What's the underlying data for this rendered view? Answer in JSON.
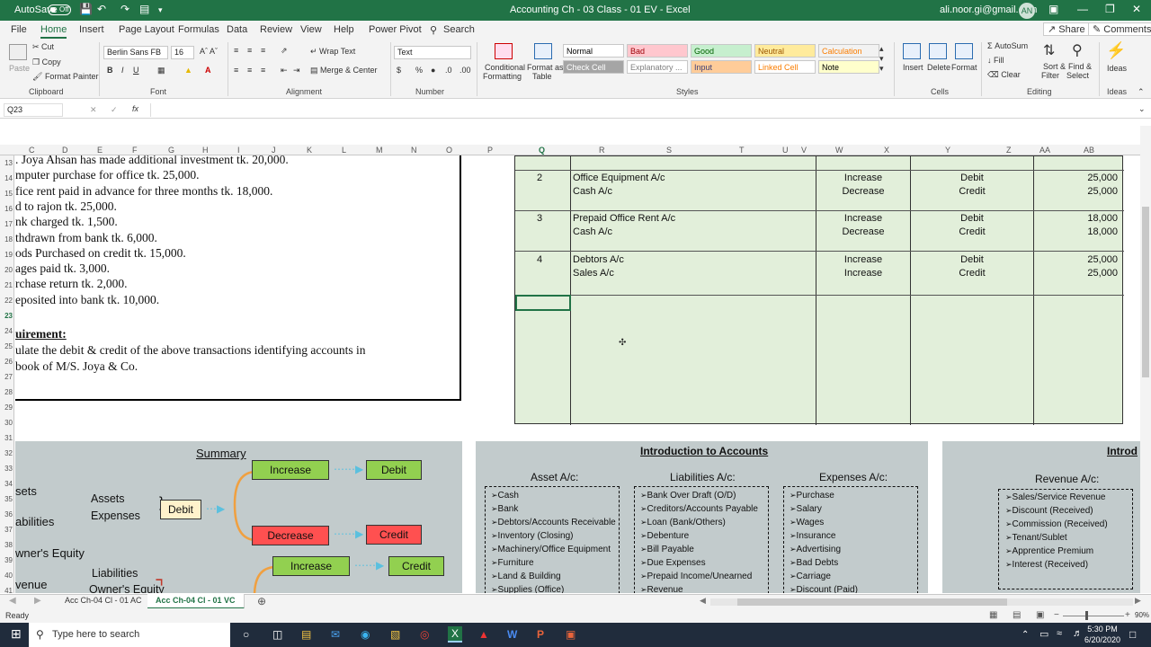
{
  "titlebar": {
    "autosave": "AutoSave",
    "toggle": "Off",
    "title": "Accounting Ch - 03 Class - 01 EV  -  Excel",
    "user": "ali.noor.gi@gmail.com",
    "avatar": "AN"
  },
  "tabs": [
    "File",
    "Home",
    "Insert",
    "Page Layout",
    "Formulas",
    "Data",
    "Review",
    "View",
    "Help",
    "Power Pivot"
  ],
  "search": "Search",
  "share": "Share",
  "comments": "Comments",
  "ribbon": {
    "paste": "Paste",
    "cut": "Cut",
    "copy": "Copy",
    "format_painter": "Format Painter",
    "clipboard": "Clipboard",
    "font_name": "Berlin Sans FB",
    "font_size": "16",
    "font": "Font",
    "wrap_text": "Wrap Text",
    "merge_center": "Merge & Center",
    "alignment": "Alignment",
    "number_format": "Text",
    "number": "Number",
    "cond_format": "Conditional",
    "cond_format2": "Formatting",
    "format_as": "Format as",
    "format_as2": "Table",
    "styles_label": "Styles",
    "styles": [
      {
        "label": "Normal",
        "bg": "#ffffff",
        "color": "#000000"
      },
      {
        "label": "Bad",
        "bg": "#ffc7ce",
        "color": "#9c0006"
      },
      {
        "label": "Good",
        "bg": "#c6efce",
        "color": "#006100"
      },
      {
        "label": "Neutral",
        "bg": "#ffeb9c",
        "color": "#9c5700"
      },
      {
        "label": "Calculation",
        "bg": "#f2f2f2",
        "color": "#fa7d00"
      },
      {
        "label": "Check Cell",
        "bg": "#a5a5a5",
        "color": "#ffffff"
      },
      {
        "label": "Explanatory ...",
        "bg": "#ffffff",
        "color": "#7f7f7f"
      },
      {
        "label": "Input",
        "bg": "#ffcc99",
        "color": "#3f3f76"
      },
      {
        "label": "Linked Cell",
        "bg": "#ffffff",
        "color": "#fa7d00"
      },
      {
        "label": "Note",
        "bg": "#ffffcc",
        "color": "#000000"
      }
    ],
    "insert": "Insert",
    "delete": "Delete",
    "format": "Format",
    "cells": "Cells",
    "autosum": "AutoSum",
    "fill": "Fill",
    "clear": "Clear",
    "sort": "Sort &",
    "sort2": "Filter",
    "find": "Find &",
    "find2": "Select",
    "editing": "Editing",
    "ideas": "Ideas",
    "ideas_group": "Ideas"
  },
  "namebox": "Q23",
  "fx": "fx",
  "columns": [
    {
      "l": "C"
    },
    {
      "l": "D"
    },
    {
      "l": "E"
    },
    {
      "l": "F"
    },
    {
      "l": "G"
    },
    {
      "l": "H"
    },
    {
      "l": "I"
    },
    {
      "l": "J"
    },
    {
      "l": "K"
    },
    {
      "l": "L"
    },
    {
      "l": "M"
    },
    {
      "l": "N"
    },
    {
      "l": "O"
    },
    {
      "l": "P"
    },
    {
      "l": "Q"
    },
    {
      "l": "R"
    },
    {
      "l": "S"
    },
    {
      "l": "T"
    },
    {
      "l": "U"
    },
    {
      "l": "V"
    },
    {
      "l": "W"
    },
    {
      "l": "X"
    },
    {
      "l": "Y"
    },
    {
      "l": "Z"
    },
    {
      "l": "AA"
    },
    {
      "l": "AB"
    }
  ],
  "rows": [
    "13",
    "14",
    "15",
    "16",
    "17",
    "18",
    "19",
    "20",
    "21",
    "22",
    "23",
    "24",
    "25",
    "26",
    "27",
    "28",
    "29",
    "30",
    "31",
    "32",
    "33",
    "34",
    "35",
    "36",
    "37",
    "38",
    "39",
    "40",
    "41"
  ],
  "question_lines": [
    ". Joya Ahsan has made additional investment tk. 20,000.",
    "mputer purchase for office tk. 25,000.",
    "fice rent paid in advance for three months tk. 18,000.",
    "d to rajon tk. 25,000.",
    "nk charged tk. 1,500.",
    "thdrawn from bank tk. 6,000.",
    "ods Purchased on credit tk. 15,000.",
    "ages paid tk. 3,000.",
    "rchase return tk. 2,000.",
    "eposited into bank tk. 10,000."
  ],
  "requirement_title": "uirement:",
  "requirement_lines": [
    "ulate the debit & credit of the above transactions identifying accounts in",
    "book of M/S. Joya & Co."
  ],
  "journal": [
    {
      "no": "2",
      "acc1": "Office Equipment A/c",
      "acc2": "Cash A/c",
      "eff1": "Increase",
      "eff2": "Decrease",
      "dc1": "Debit",
      "dc2": "Credit",
      "amt1": "25,000",
      "amt2": "25,000"
    },
    {
      "no": "3",
      "acc1": "Prepaid Office Rent A/c",
      "acc2": "Cash A/c",
      "eff1": "Increase",
      "eff2": "Decrease",
      "dc1": "Debit",
      "dc2": "Credit",
      "amt1": "18,000",
      "amt2": "18,000"
    },
    {
      "no": "4",
      "acc1": "Debtors A/c",
      "acc2": "Sales A/c",
      "eff1": "Increase",
      "eff2": "Increase",
      "dc1": "Debit",
      "dc2": "Credit",
      "amt1": "25,000",
      "amt2": "25,000"
    }
  ],
  "summary": {
    "title": "Summary",
    "left_labels": [
      "sets",
      "abilities",
      "wner's Equity",
      "venue"
    ],
    "assets_expenses": [
      "Assets",
      "Expenses"
    ],
    "liabilities": "Liabilities",
    "owners_equity": "Owner's Equity",
    "debit_box": "Debit",
    "increase1": "Increase",
    "debit1": "Debit",
    "decrease1": "Decrease",
    "credit1": "Credit",
    "increase2": "Increase",
    "credit2": "Credit"
  },
  "intro": {
    "title": "Introduction to Accounts",
    "asset_title": "Asset A/c:",
    "assets": [
      "Cash",
      "Bank",
      "Debtors/Accounts Receivable",
      "Inventory (Closing)",
      "Machinery/Office Equipment",
      "Furniture",
      "Land & Building",
      "Supplies (Office)"
    ],
    "liab_title": "Liabilities A/c:",
    "liabilities": [
      "Bank Over Draft (O/D)",
      "Creditors/Accounts Payable",
      "Loan (Bank/Others)",
      "Debenture",
      "Bill Payable",
      "Due Expenses",
      "Prepaid Income/Unearned",
      "Revenue"
    ],
    "exp_title": "Expenses A/c:",
    "expenses": [
      "Purchase",
      "Salary",
      "Wages",
      "Insurance",
      "Advertising",
      "Bad Debts",
      "Carriage",
      "Discount (Paid)"
    ]
  },
  "intro2": {
    "title": "Introd",
    "rev_title": "Revenue A/c:",
    "revenues": [
      "Sales/Service Revenue",
      "Discount (Received)",
      "Commission (Received)",
      "Tenant/Sublet",
      "Apprentice Premium",
      "Interest (Received)"
    ]
  },
  "sheets": [
    "Acc Ch-04 Cl - 01 AC",
    "Acc Ch-04 Cl - 01 VC"
  ],
  "status": {
    "ready": "Ready",
    "zoom": "90%"
  },
  "taskbar": {
    "search": "Type here to search",
    "time": "5:30 PM",
    "date": "6/20/2020"
  },
  "colors": {
    "excel_green": "#217346",
    "journal_bg": "#e2efda",
    "increase_green": "#92d050",
    "decrease_red": "#ff5050",
    "debit_box": "#fff2cc"
  }
}
